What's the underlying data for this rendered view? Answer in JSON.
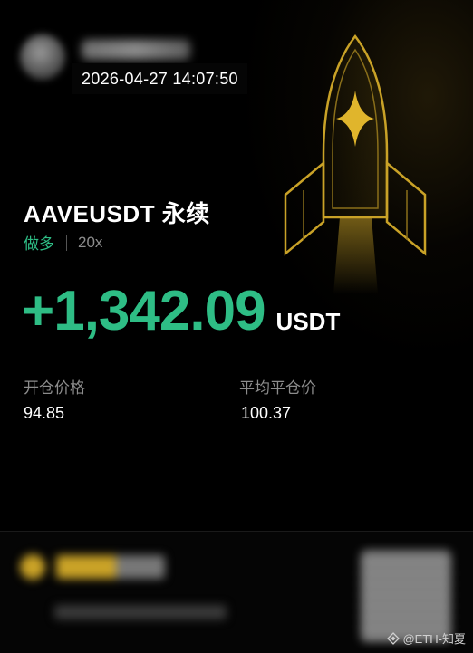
{
  "timestamp": "2026-04-27 14:07:50",
  "position": {
    "pair": "AAVEUSDT 永续",
    "side": "做多",
    "leverage": "20x"
  },
  "pnl": {
    "value": "+1,342.09",
    "unit": "USDT"
  },
  "stats": {
    "entry_label": "开仓价格",
    "entry_value": "94.85",
    "close_label": "平均平仓价",
    "close_value": "100.37"
  },
  "watermark": {
    "text": "@ETH-知夏"
  },
  "colors": {
    "profit_green": "#2ebd85",
    "label_gray": "#8c8c8c",
    "rocket_gold": "#c9a227",
    "background": "#000000"
  },
  "icons": {
    "rocket": "rocket-illustration",
    "watermark": "diamond-logo-icon"
  }
}
